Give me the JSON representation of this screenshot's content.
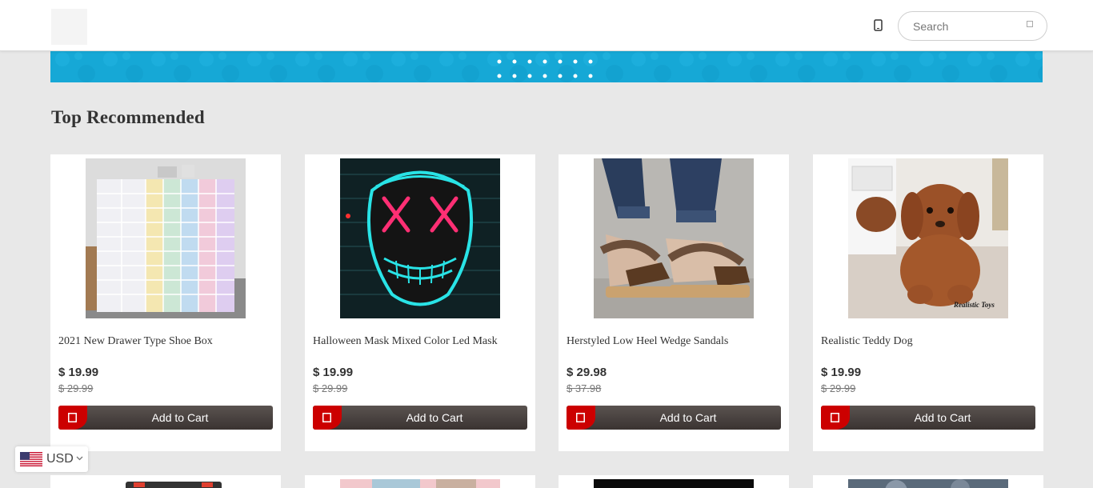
{
  "header": {
    "search_placeholder": "Search"
  },
  "section": {
    "title": "Top Recommended"
  },
  "products": [
    {
      "name": "2021 New Drawer Type Shoe Box",
      "price": "$ 19.99",
      "old_price": "$ 29.99",
      "cart_label": "Add to Cart"
    },
    {
      "name": "Halloween Mask Mixed Color Led Mask",
      "price": "$ 19.99",
      "old_price": "$ 29.99",
      "cart_label": "Add to Cart"
    },
    {
      "name": "Herstyled Low Heel Wedge Sandals",
      "price": "$ 29.98",
      "old_price": "$ 37.98",
      "cart_label": "Add to Cart"
    },
    {
      "name": "Realistic Teddy Dog",
      "price": "$ 19.99",
      "old_price": "$ 29.99",
      "cart_label": "Add to Cart"
    }
  ],
  "product_images": {
    "dog_watermark": "Realistic Toys"
  },
  "currency": {
    "code": "USD"
  },
  "colors": {
    "accent_red": "#cc0000",
    "button_dark": "#3a3331",
    "banner_blue": "#16a8d6"
  },
  "icons": [
    "phone-icon",
    "search-icon",
    "cart-icon",
    "us-flag-icon",
    "chevron-down-icon"
  ]
}
